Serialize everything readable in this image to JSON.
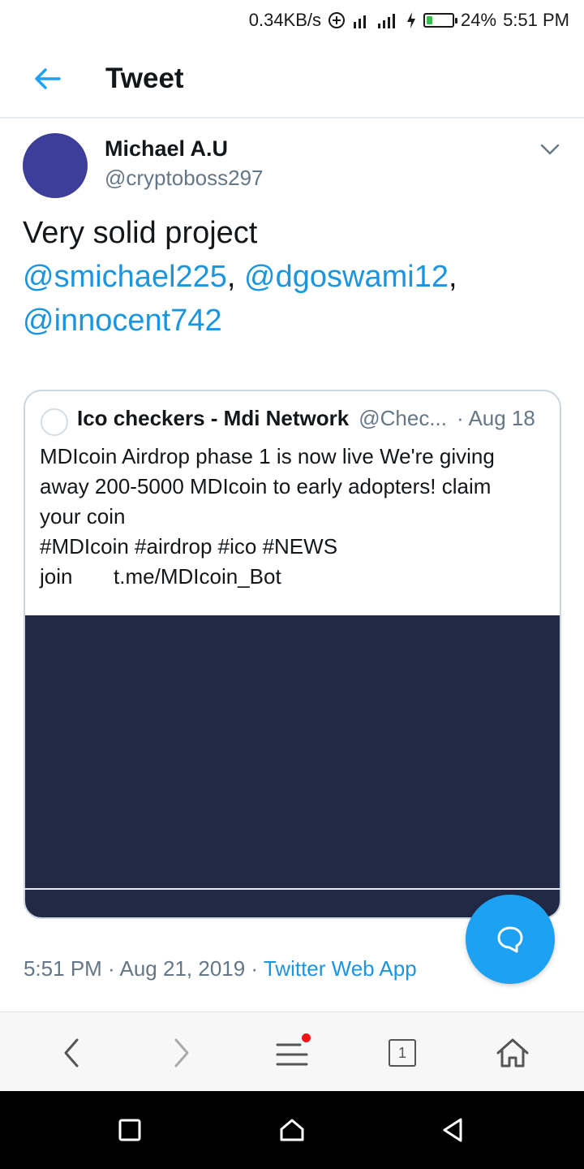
{
  "status_bar": {
    "speed": "0.34KB/s",
    "battery": "24%",
    "battery_level": 0.24,
    "time": "5:51 PM"
  },
  "header": {
    "title": "Tweet"
  },
  "tweet": {
    "author": {
      "name": "Michael A.U",
      "handle": "@cryptoboss297",
      "avatar_color": "#3d3d9a"
    },
    "text": {
      "plain": "Very solid project",
      "mentions": [
        "@smichael225",
        "@dgoswami12",
        "@innocent742"
      ],
      "sep1": ", ",
      "sep2": ","
    },
    "quote": {
      "author_name": "Ico checkers - Mdi Network",
      "author_handle": "@Chec...",
      "date": "· Aug 18",
      "lines": [
        "MDIcoin Airdrop phase 1 is now live We're giving",
        "away 200-5000 MDIcoin to early adopters! claim",
        "your coin",
        "#MDIcoin #airdrop #ico #NEWS",
        "join       t.me/MDIcoin_Bot"
      ],
      "media_color": "#212945"
    },
    "meta": {
      "time": "5:51 PM",
      "sep1": " · ",
      "date": "Aug 21, 2019",
      "sep2": " · ",
      "source": "Twitter Web App"
    }
  },
  "browser_bar": {
    "tab_count": "1"
  },
  "colors": {
    "accent": "#1da1f2",
    "link": "#1b95e0",
    "secondary_text": "#657786",
    "notification_dot": "#f2141a"
  },
  "icons": [
    "back-arrow-icon",
    "chevron-down-icon",
    "compose-reply-icon",
    "browser-back-icon",
    "browser-forward-icon",
    "menu-icon",
    "tabs-icon",
    "home-icon",
    "recents-icon",
    "nav-home-icon",
    "nav-back-icon"
  ]
}
